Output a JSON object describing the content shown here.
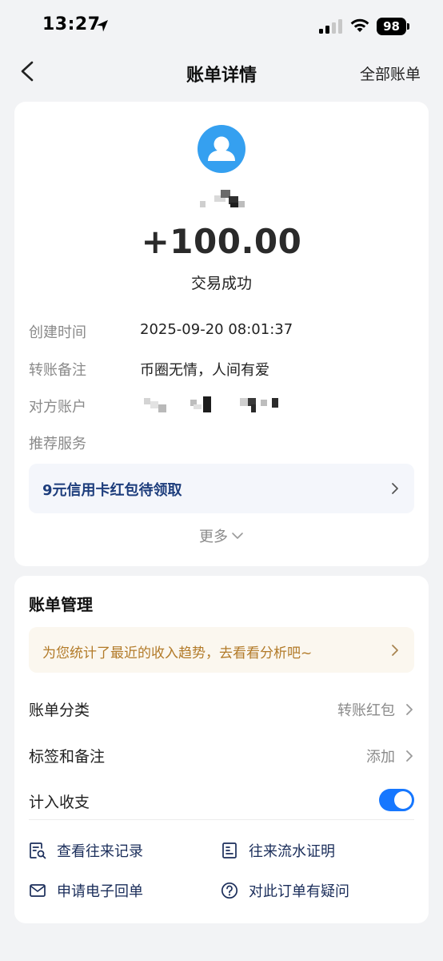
{
  "status_bar": {
    "time": "13:27",
    "battery": "98"
  },
  "nav": {
    "title": "账单详情",
    "right_link": "全部账单"
  },
  "transaction": {
    "amount": "+100.00",
    "status": "交易成功"
  },
  "details": [
    {
      "label": "创建时间",
      "value": "2025-09-20 08:01:37"
    },
    {
      "label": "转账备注",
      "value": "币圈无情，人间有爱"
    },
    {
      "label": "对方账户",
      "value": ""
    },
    {
      "label": "推荐服务",
      "value": ""
    }
  ],
  "promo": {
    "text": "9元信用卡红包待领取"
  },
  "more": {
    "label": "更多"
  },
  "management": {
    "title": "账单管理",
    "tip": "为您统计了最近的收入趋势，去看看分析吧~",
    "rows": [
      {
        "label": "账单分类",
        "value": "转账红包"
      },
      {
        "label": "标签和备注",
        "value": "添加"
      },
      {
        "label": "计入收支",
        "toggle_on": true
      }
    ],
    "actions": [
      {
        "label": "查看往来记录",
        "icon": "record-search-icon"
      },
      {
        "label": "往来流水证明",
        "icon": "statement-icon"
      },
      {
        "label": "申请电子回单",
        "icon": "mail-icon"
      },
      {
        "label": "对此订单有疑问",
        "icon": "question-icon"
      }
    ]
  },
  "colors": {
    "accent": "#1677ff",
    "avatar": "#35a0f0",
    "promo_text": "#1d3d7c",
    "tip_text": "#b27a28",
    "tip_bg": "#fbf7ef"
  }
}
